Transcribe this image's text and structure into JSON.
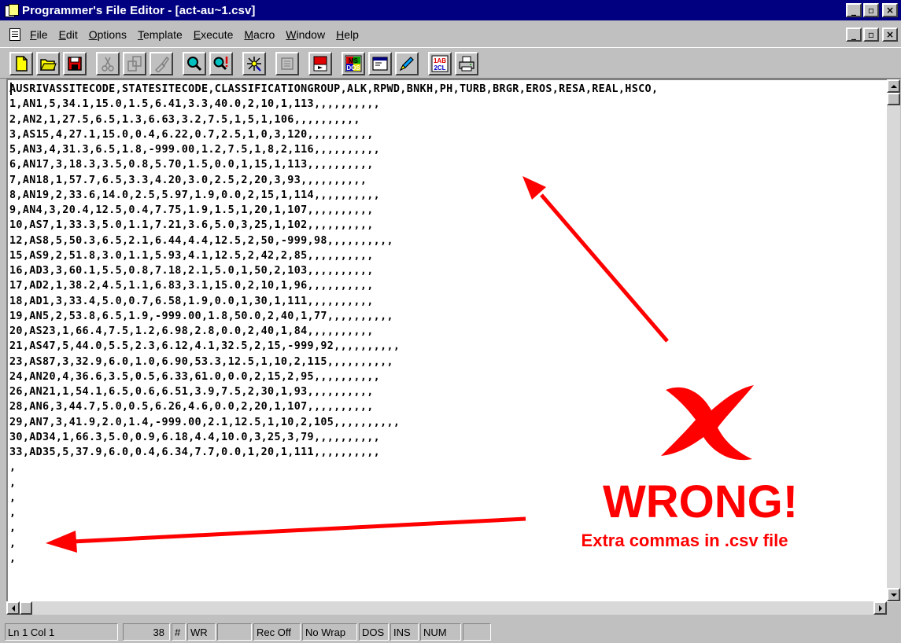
{
  "window": {
    "title": "Programmer's File Editor - [act-au~1.csv]",
    "buttons": {
      "minimize": "_",
      "maximize": "▫",
      "close": "×"
    }
  },
  "menu": {
    "items": [
      "File",
      "Edit",
      "Options",
      "Template",
      "Execute",
      "Macro",
      "Window",
      "Help"
    ]
  },
  "toolbar": {
    "buttons": [
      "new",
      "open",
      "save",
      "cut",
      "copy",
      "paste",
      "find",
      "find-next",
      "clear",
      "stamp",
      "run",
      "ms-dos",
      "window",
      "edit-tool",
      "abc-tool",
      "print"
    ],
    "label_msdos": "MS DOS",
    "label_abc": "1AB 2CL"
  },
  "editor": {
    "lines": [
      "AUSRIVASSITECODE,STATESITECODE,CLASSIFICATIONGROUP,ALK,RPWD,BNKH,PH,TURB,BRGR,EROS,RESA,REAL,HSCO,",
      "1,AN1,5,34.1,15.0,1.5,6.41,3.3,40.0,2,10,1,113,,,,,,,,,,",
      "2,AN2,1,27.5,6.5,1.3,6.63,3.2,7.5,1,5,1,106,,,,,,,,,,",
      "3,AS15,4,27.1,15.0,0.4,6.22,0.7,2.5,1,0,3,120,,,,,,,,,,",
      "5,AN3,4,31.3,6.5,1.8,-999.00,1.2,7.5,1,8,2,116,,,,,,,,,,",
      "6,AN17,3,18.3,3.5,0.8,5.70,1.5,0.0,1,15,1,113,,,,,,,,,,",
      "7,AN18,1,57.7,6.5,3.3,4.20,3.0,2.5,2,20,3,93,,,,,,,,,,",
      "8,AN19,2,33.6,14.0,2.5,5.97,1.9,0.0,2,15,1,114,,,,,,,,,,",
      "9,AN4,3,20.4,12.5,0.4,7.75,1.9,1.5,1,20,1,107,,,,,,,,,,",
      "10,AS7,1,33.3,5.0,1.1,7.21,3.6,5.0,3,25,1,102,,,,,,,,,,",
      "12,AS8,5,50.3,6.5,2.1,6.44,4.4,12.5,2,50,-999,98,,,,,,,,,,",
      "15,AS9,2,51.8,3.0,1.1,5.93,4.1,12.5,2,42,2,85,,,,,,,,,,",
      "16,AD3,3,60.1,5.5,0.8,7.18,2.1,5.0,1,50,2,103,,,,,,,,,,",
      "17,AD2,1,38.2,4.5,1.1,6.83,3.1,15.0,2,10,1,96,,,,,,,,,,",
      "18,AD1,3,33.4,5.0,0.7,6.58,1.9,0.0,1,30,1,111,,,,,,,,,,",
      "19,AN5,2,53.8,6.5,1.9,-999.00,1.8,50.0,2,40,1,77,,,,,,,,,,",
      "20,AS23,1,66.4,7.5,1.2,6.98,2.8,0.0,2,40,1,84,,,,,,,,,,",
      "21,AS47,5,44.0,5.5,2.3,6.12,4.1,32.5,2,15,-999,92,,,,,,,,,,",
      "23,AS87,3,32.9,6.0,1.0,6.90,53.3,12.5,1,10,2,115,,,,,,,,,,",
      "24,AN20,4,36.6,3.5,0.5,6.33,61.0,0.0,2,15,2,95,,,,,,,,,,",
      "26,AN21,1,54.1,6.5,0.6,6.51,3.9,7.5,2,30,1,93,,,,,,,,,,",
      "28,AN6,3,44.7,5.0,0.5,6.26,4.6,0.0,2,20,1,107,,,,,,,,,,",
      "29,AN7,3,41.9,2.0,1.4,-999.00,2.1,12.5,1,10,2,105,,,,,,,,,,",
      "30,AD34,1,66.3,5.0,0.9,6.18,4.4,10.0,3,25,3,79,,,,,,,,,,",
      "33,AD35,5,37.9,6.0,0.4,6.34,7.7,0.0,1,20,1,111,,,,,,,,,,",
      ",",
      ",",
      ",",
      ",",
      ",",
      ",",
      ","
    ]
  },
  "statusbar": {
    "position": "Ln 1 Col 1",
    "count": "38",
    "hash": "#",
    "mode": "WR",
    "rec": "Rec Off",
    "wrap": "No Wrap",
    "format": "DOS",
    "ins": "INS",
    "num": "NUM"
  },
  "annotation": {
    "title": "WRONG!",
    "subtitle": "Extra commas in .csv file",
    "color": "#ff0000"
  }
}
